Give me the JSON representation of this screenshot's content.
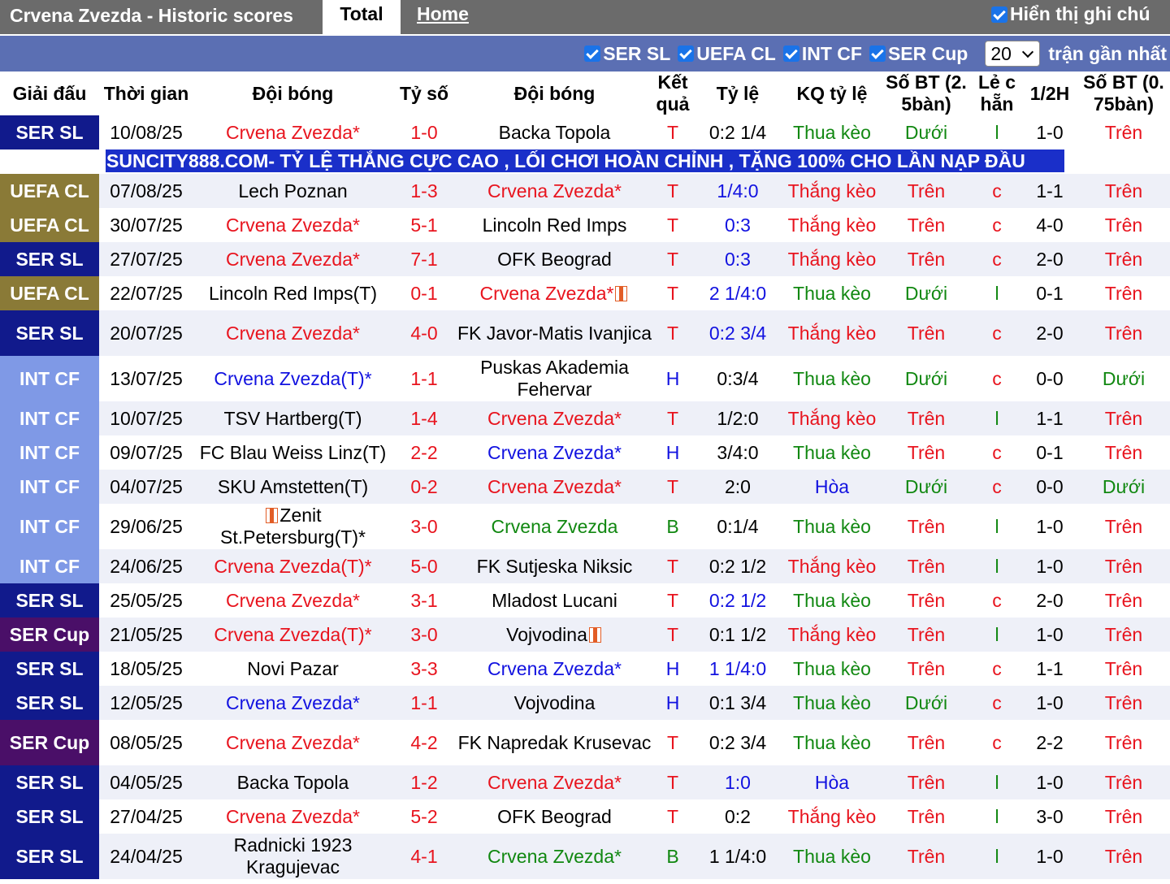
{
  "header": {
    "title": "Crvena Zvezda - Historic scores",
    "tab_total": "Total",
    "tab_home": "Home",
    "notes_label": "Hiển thị ghi chú"
  },
  "filters": {
    "items": [
      "SER SL",
      "UEFA CL",
      "INT CF",
      "SER Cup"
    ],
    "count_value": "20",
    "count_suffix": "trận gần nhất"
  },
  "columns": [
    "Giải đấu",
    "Thời gian",
    "Đội bóng",
    "Tỷ số",
    "Đội bóng",
    "Kết quả",
    "Tỷ lệ",
    "KQ tỷ lệ",
    "Số BT (2. 5bàn)",
    "Lẻ c hẵn",
    "1/2H",
    "Số BT (0. 75bàn)"
  ],
  "ad_text": "SUNCITY888.COM- TỶ LỆ THẮNG CỰC CAO , LỐI CHƠI HOÀN CHỈNH , TẶNG 100% CHO LẦN NẠP ĐẦU",
  "colors": {
    "sersl": "#111a8c",
    "uefa": "#8a7a37",
    "intcf": "#7f99e6",
    "sercup": "#4a0f68",
    "red": "#e8141e",
    "blue": "#1212e0",
    "green": "#118811"
  },
  "rows": [
    {
      "league": "SER SL",
      "lc": "sersl",
      "date": "10/08/25",
      "home": "Crvena Zvezda*",
      "hc": "red",
      "score": "1-0",
      "away": "Backa Topola",
      "ac": "black",
      "result": "T",
      "rc": "red",
      "hcp": "0:2 1/4",
      "hcpc": "black",
      "kq": "Thua kèo",
      "kqc": "green",
      "ou": "Dưới",
      "ouc": "green",
      "oe": "l",
      "oec": "green",
      "half": "1-0",
      "ou2": "Trên",
      "ou2c": "red"
    },
    {
      "league": "UEFA CL",
      "lc": "uefa",
      "date": "07/08/25",
      "home": "Lech Poznan",
      "hc": "black",
      "score": "1-3",
      "away": "Crvena Zvezda*",
      "ac": "red",
      "result": "T",
      "rc": "red",
      "hcp": "1/4:0",
      "hcpc": "blue",
      "kq": "Thắng kèo",
      "kqc": "red",
      "ou": "Trên",
      "ouc": "red",
      "oe": "c",
      "oec": "red",
      "half": "1-1",
      "ou2": "Trên",
      "ou2c": "red"
    },
    {
      "league": "UEFA CL",
      "lc": "uefa",
      "date": "30/07/25",
      "home": "Crvena Zvezda*",
      "hc": "red",
      "score": "5-1",
      "away": "Lincoln Red Imps",
      "ac": "black",
      "result": "T",
      "rc": "red",
      "hcp": "0:3",
      "hcpc": "blue",
      "kq": "Thắng kèo",
      "kqc": "red",
      "ou": "Trên",
      "ouc": "red",
      "oe": "c",
      "oec": "red",
      "half": "4-0",
      "ou2": "Trên",
      "ou2c": "red"
    },
    {
      "league": "SER SL",
      "lc": "sersl",
      "date": "27/07/25",
      "home": "Crvena Zvezda*",
      "hc": "red",
      "score": "7-1",
      "away": "OFK Beograd",
      "ac": "black",
      "result": "T",
      "rc": "red",
      "hcp": "0:3",
      "hcpc": "blue",
      "kq": "Thắng kèo",
      "kqc": "red",
      "ou": "Trên",
      "ouc": "red",
      "oe": "c",
      "oec": "red",
      "half": "2-0",
      "ou2": "Trên",
      "ou2c": "red"
    },
    {
      "league": "UEFA CL",
      "lc": "uefa",
      "date": "22/07/25",
      "home": "Lincoln Red Imps(T)",
      "hc": "black",
      "score": "0-1",
      "away": "Crvena Zvezda*",
      "ac": "red",
      "aflag": true,
      "result": "T",
      "rc": "red",
      "hcp": "2 1/4:0",
      "hcpc": "blue",
      "kq": "Thua kèo",
      "kqc": "green",
      "ou": "Dưới",
      "ouc": "green",
      "oe": "l",
      "oec": "green",
      "half": "0-1",
      "ou2": "Trên",
      "ou2c": "red"
    },
    {
      "league": "SER SL",
      "lc": "sersl",
      "date": "20/07/25",
      "home": "Crvena Zvezda*",
      "hc": "red",
      "score": "4-0",
      "away": "FK Javor-Matis Ivanjica",
      "ac": "black",
      "tall": true,
      "result": "T",
      "rc": "red",
      "hcp": "0:2 3/4",
      "hcpc": "blue",
      "kq": "Thắng kèo",
      "kqc": "red",
      "ou": "Trên",
      "ouc": "red",
      "oe": "c",
      "oec": "red",
      "half": "2-0",
      "ou2": "Trên",
      "ou2c": "red"
    },
    {
      "league": "INT CF",
      "lc": "intcf",
      "date": "13/07/25",
      "home": "Crvena Zvezda(T)*",
      "hc": "blue",
      "score": "1-1",
      "away": "Puskas Akademia Fehervar",
      "ac": "black",
      "tall": true,
      "result": "H",
      "rc": "blue",
      "hcp": "0:3/4",
      "hcpc": "black",
      "kq": "Thua kèo",
      "kqc": "green",
      "ou": "Dưới",
      "ouc": "green",
      "oe": "c",
      "oec": "red",
      "half": "0-0",
      "ou2": "Dưới",
      "ou2c": "green"
    },
    {
      "league": "INT CF",
      "lc": "intcf",
      "date": "10/07/25",
      "home": "TSV Hartberg(T)",
      "hc": "black",
      "score": "1-4",
      "away": "Crvena Zvezda*",
      "ac": "red",
      "result": "T",
      "rc": "red",
      "hcp": "1/2:0",
      "hcpc": "black",
      "kq": "Thắng kèo",
      "kqc": "red",
      "ou": "Trên",
      "ouc": "red",
      "oe": "l",
      "oec": "green",
      "half": "1-1",
      "ou2": "Trên",
      "ou2c": "red"
    },
    {
      "league": "INT CF",
      "lc": "intcf",
      "date": "09/07/25",
      "home": "FC Blau Weiss Linz(T)",
      "hc": "black",
      "score": "2-2",
      "away": "Crvena Zvezda*",
      "ac": "blue",
      "result": "H",
      "rc": "blue",
      "hcp": "3/4:0",
      "hcpc": "black",
      "kq": "Thua kèo",
      "kqc": "green",
      "ou": "Trên",
      "ouc": "red",
      "oe": "c",
      "oec": "red",
      "half": "0-1",
      "ou2": "Trên",
      "ou2c": "red"
    },
    {
      "league": "INT CF",
      "lc": "intcf",
      "date": "04/07/25",
      "home": "SKU Amstetten(T)",
      "hc": "black",
      "score": "0-2",
      "away": "Crvena Zvezda*",
      "ac": "red",
      "result": "T",
      "rc": "red",
      "hcp": "2:0",
      "hcpc": "black",
      "kq": "Hòa",
      "kqc": "blue",
      "ou": "Dưới",
      "ouc": "green",
      "oe": "c",
      "oec": "red",
      "half": "0-0",
      "ou2": "Dưới",
      "ou2c": "green"
    },
    {
      "league": "INT CF",
      "lc": "intcf",
      "date": "29/06/25",
      "home": "Zenit St.Petersburg(T)*",
      "hc": "black",
      "hflag": true,
      "tall": true,
      "score": "3-0",
      "away": "Crvena Zvezda",
      "ac": "green",
      "result": "B",
      "rc": "green",
      "hcp": "0:1/4",
      "hcpc": "black",
      "kq": "Thua kèo",
      "kqc": "green",
      "ou": "Trên",
      "ouc": "red",
      "oe": "l",
      "oec": "green",
      "half": "1-0",
      "ou2": "Trên",
      "ou2c": "red"
    },
    {
      "league": "INT CF",
      "lc": "intcf",
      "date": "24/06/25",
      "home": "Crvena Zvezda(T)*",
      "hc": "red",
      "score": "5-0",
      "away": "FK Sutjeska Niksic",
      "ac": "black",
      "result": "T",
      "rc": "red",
      "hcp": "0:2 1/2",
      "hcpc": "black",
      "kq": "Thắng kèo",
      "kqc": "red",
      "ou": "Trên",
      "ouc": "red",
      "oe": "l",
      "oec": "green",
      "half": "1-0",
      "ou2": "Trên",
      "ou2c": "red"
    },
    {
      "league": "SER SL",
      "lc": "sersl",
      "date": "25/05/25",
      "home": "Crvena Zvezda*",
      "hc": "red",
      "score": "3-1",
      "away": "Mladost Lucani",
      "ac": "black",
      "result": "T",
      "rc": "red",
      "hcp": "0:2 1/2",
      "hcpc": "blue",
      "kq": "Thua kèo",
      "kqc": "green",
      "ou": "Trên",
      "ouc": "red",
      "oe": "c",
      "oec": "red",
      "half": "2-0",
      "ou2": "Trên",
      "ou2c": "red"
    },
    {
      "league": "SER Cup",
      "lc": "sercup",
      "date": "21/05/25",
      "home": "Crvena Zvezda(T)*",
      "hc": "red",
      "score": "3-0",
      "away": "Vojvodina",
      "ac": "black",
      "aflag": true,
      "result": "T",
      "rc": "red",
      "hcp": "0:1 1/2",
      "hcpc": "black",
      "kq": "Thắng kèo",
      "kqc": "red",
      "ou": "Trên",
      "ouc": "red",
      "oe": "l",
      "oec": "green",
      "half": "1-0",
      "ou2": "Trên",
      "ou2c": "red"
    },
    {
      "league": "SER SL",
      "lc": "sersl",
      "date": "18/05/25",
      "home": "Novi Pazar",
      "hc": "black",
      "score": "3-3",
      "away": "Crvena Zvezda*",
      "ac": "blue",
      "result": "H",
      "rc": "blue",
      "hcp": "1 1/4:0",
      "hcpc": "blue",
      "kq": "Thua kèo",
      "kqc": "green",
      "ou": "Trên",
      "ouc": "red",
      "oe": "c",
      "oec": "red",
      "half": "1-1",
      "ou2": "Trên",
      "ou2c": "red"
    },
    {
      "league": "SER SL",
      "lc": "sersl",
      "date": "12/05/25",
      "home": "Crvena Zvezda*",
      "hc": "blue",
      "score": "1-1",
      "away": "Vojvodina",
      "ac": "black",
      "result": "H",
      "rc": "blue",
      "hcp": "0:1 3/4",
      "hcpc": "black",
      "kq": "Thua kèo",
      "kqc": "green",
      "ou": "Dưới",
      "ouc": "green",
      "oe": "c",
      "oec": "red",
      "half": "1-0",
      "ou2": "Trên",
      "ou2c": "red"
    },
    {
      "league": "SER Cup",
      "lc": "sercup",
      "date": "08/05/25",
      "home": "Crvena Zvezda*",
      "hc": "red",
      "score": "4-2",
      "away": "FK Napredak Krusevac",
      "ac": "black",
      "tall": true,
      "result": "T",
      "rc": "red",
      "hcp": "0:2 3/4",
      "hcpc": "black",
      "kq": "Thua kèo",
      "kqc": "green",
      "ou": "Trên",
      "ouc": "red",
      "oe": "c",
      "oec": "red",
      "half": "2-2",
      "ou2": "Trên",
      "ou2c": "red"
    },
    {
      "league": "SER SL",
      "lc": "sersl",
      "date": "04/05/25",
      "home": "Backa Topola",
      "hc": "black",
      "score": "1-2",
      "away": "Crvena Zvezda*",
      "ac": "red",
      "result": "T",
      "rc": "red",
      "hcp": "1:0",
      "hcpc": "blue",
      "kq": "Hòa",
      "kqc": "blue",
      "ou": "Trên",
      "ouc": "red",
      "oe": "l",
      "oec": "green",
      "half": "1-0",
      "ou2": "Trên",
      "ou2c": "red"
    },
    {
      "league": "SER SL",
      "lc": "sersl",
      "date": "27/04/25",
      "home": "Crvena Zvezda*",
      "hc": "red",
      "score": "5-2",
      "away": "OFK Beograd",
      "ac": "black",
      "result": "T",
      "rc": "red",
      "hcp": "0:2",
      "hcpc": "black",
      "kq": "Thắng kèo",
      "kqc": "red",
      "ou": "Trên",
      "ouc": "red",
      "oe": "l",
      "oec": "green",
      "half": "3-0",
      "ou2": "Trên",
      "ou2c": "red"
    },
    {
      "league": "SER SL",
      "lc": "sersl",
      "date": "24/04/25",
      "home": "Radnicki 1923 Kragujevac",
      "hc": "black",
      "tall": true,
      "score": "4-1",
      "away": "Crvena Zvezda*",
      "ac": "green",
      "result": "B",
      "rc": "green",
      "hcp": "1 1/4:0",
      "hcpc": "black",
      "kq": "Thua kèo",
      "kqc": "green",
      "ou": "Trên",
      "ouc": "red",
      "oe": "l",
      "oec": "green",
      "half": "1-0",
      "ou2": "Trên",
      "ou2c": "red"
    }
  ]
}
